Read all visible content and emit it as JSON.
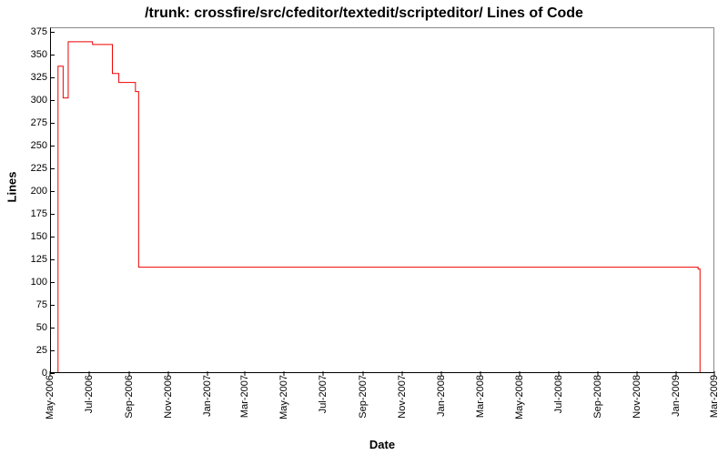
{
  "chart_data": {
    "type": "line",
    "title": "/trunk: crossfire/src/cfeditor/textedit/scripteditor/ Lines of Code",
    "xlabel": "Date",
    "ylabel": "Lines",
    "ylim": [
      0,
      380
    ],
    "yticks": [
      0,
      25,
      50,
      75,
      100,
      125,
      150,
      175,
      200,
      225,
      250,
      275,
      300,
      325,
      350,
      375
    ],
    "xticks": [
      "May-2006",
      "Jul-2006",
      "Sep-2006",
      "Nov-2006",
      "Jan-2007",
      "Mar-2007",
      "May-2007",
      "Jul-2007",
      "Sep-2007",
      "Nov-2007",
      "Jan-2008",
      "Mar-2008",
      "May-2008",
      "Jul-2008",
      "Sep-2008",
      "Nov-2008",
      "Jan-2009",
      "Mar-2009"
    ],
    "series": [
      {
        "name": "Lines of Code",
        "color": "#ee0000",
        "points": [
          {
            "x": "2006-05-12",
            "y": 0
          },
          {
            "x": "2006-05-12",
            "y": 338
          },
          {
            "x": "2006-05-20",
            "y": 338
          },
          {
            "x": "2006-05-20",
            "y": 303
          },
          {
            "x": "2006-05-28",
            "y": 303
          },
          {
            "x": "2006-05-28",
            "y": 365
          },
          {
            "x": "2006-07-05",
            "y": 365
          },
          {
            "x": "2006-07-05",
            "y": 362
          },
          {
            "x": "2006-08-05",
            "y": 362
          },
          {
            "x": "2006-08-05",
            "y": 330
          },
          {
            "x": "2006-08-15",
            "y": 330
          },
          {
            "x": "2006-08-15",
            "y": 320
          },
          {
            "x": "2006-09-10",
            "y": 320
          },
          {
            "x": "2006-09-10",
            "y": 310
          },
          {
            "x": "2006-09-15",
            "y": 310
          },
          {
            "x": "2006-09-15",
            "y": 116
          },
          {
            "x": "2009-02-05",
            "y": 116
          },
          {
            "x": "2009-02-05",
            "y": 114
          },
          {
            "x": "2009-02-08",
            "y": 114
          },
          {
            "x": "2009-02-08",
            "y": 0
          }
        ]
      }
    ]
  }
}
